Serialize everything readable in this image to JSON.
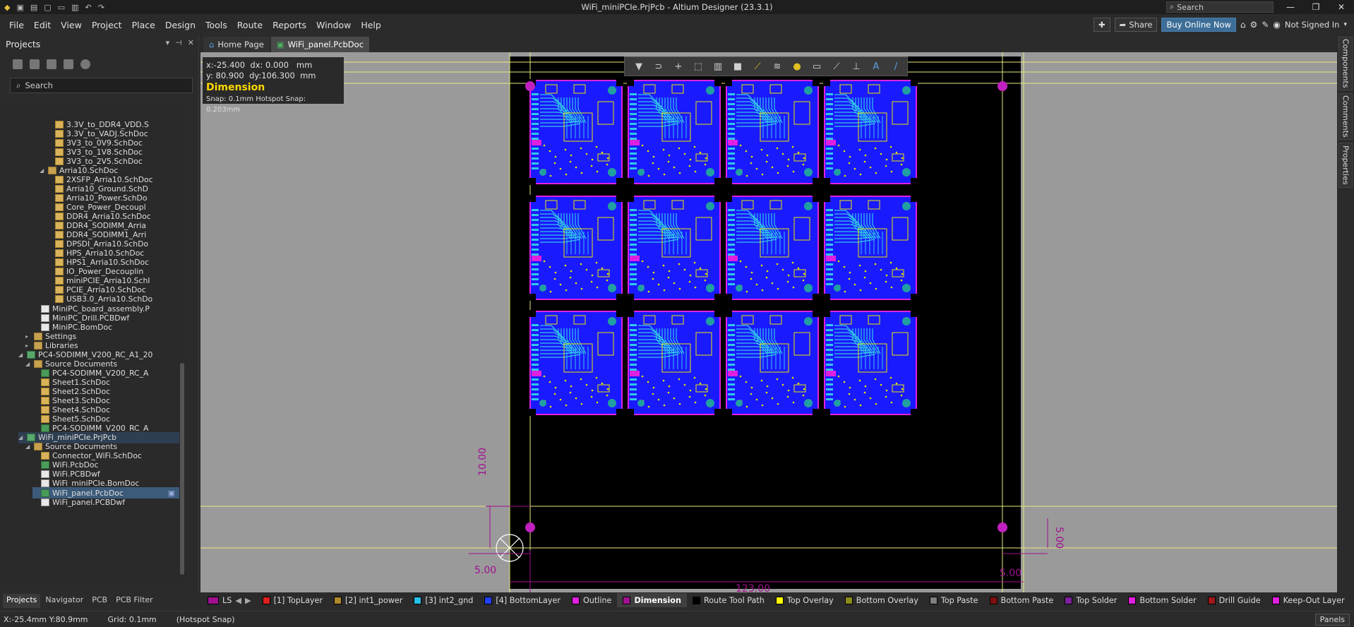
{
  "window": {
    "title": "WiFi_miniPCIe.PrjPcb - Altium Designer (23.3.1)",
    "search_placeholder": "Search"
  },
  "menu": [
    "File",
    "Edit",
    "View",
    "Project",
    "Place",
    "Design",
    "Tools",
    "Route",
    "Reports",
    "Window",
    "Help"
  ],
  "header_right": {
    "share": "Share",
    "buy": "Buy Online Now",
    "user": "Not Signed In"
  },
  "projects_panel": {
    "title": "Projects",
    "search_placeholder": "Search",
    "tabs": [
      "Projects",
      "Navigator",
      "PCB",
      "PCB Filter"
    ]
  },
  "tree": [
    {
      "label": "3.3V_to_DDR4_VDD.S",
      "type": "sch",
      "indent": 4
    },
    {
      "label": "3.3V_to_VADJ.SchDoc",
      "type": "sch",
      "indent": 4
    },
    {
      "label": "3V3_to_0V9.SchDoc",
      "type": "sch",
      "indent": 4
    },
    {
      "label": "3V3_to_1V8.SchDoc",
      "type": "sch",
      "indent": 4
    },
    {
      "label": "3V3_to_2V5.SchDoc",
      "type": "sch",
      "indent": 4
    },
    {
      "label": "Arria10.SchDoc",
      "type": "folder",
      "indent": 3,
      "arrow": "▲"
    },
    {
      "label": "2XSFP_Arria10.SchDoc",
      "type": "sch",
      "indent": 4
    },
    {
      "label": "Arria10_Ground.SchD",
      "type": "sch",
      "indent": 4
    },
    {
      "label": "Arria10_Power.SchDo",
      "type": "sch",
      "indent": 4
    },
    {
      "label": "Core_Power_Decoupl",
      "type": "sch",
      "indent": 4
    },
    {
      "label": "DDR4_Arria10.SchDoc",
      "type": "sch",
      "indent": 4
    },
    {
      "label": "DDR4_SODIMM_Arria",
      "type": "sch",
      "indent": 4
    },
    {
      "label": "DDR4_SODIMM1_Arri",
      "type": "sch",
      "indent": 4
    },
    {
      "label": "DPSDI_Arria10.SchDo",
      "type": "sch",
      "indent": 4
    },
    {
      "label": "HPS_Arria10.SchDoc",
      "type": "sch",
      "indent": 4
    },
    {
      "label": "HPS1_Arria10.SchDoc",
      "type": "sch",
      "indent": 4
    },
    {
      "label": "IO_Power_Decouplin",
      "type": "sch",
      "indent": 4
    },
    {
      "label": "miniPCIE_Arria10.SchI",
      "type": "sch",
      "indent": 4
    },
    {
      "label": "PCIE_Arria10.SchDoc",
      "type": "sch",
      "indent": 4
    },
    {
      "label": "USB3.0_Arria10.SchDo",
      "type": "sch",
      "indent": 4
    },
    {
      "label": "MiniPC_board_assembly.P",
      "type": "doc",
      "indent": 2
    },
    {
      "label": "MiniPC_Drill.PCBDwf",
      "type": "doc",
      "indent": 2
    },
    {
      "label": "MiniPC.BomDoc",
      "type": "doc",
      "indent": 2
    },
    {
      "label": "Settings",
      "type": "folder",
      "indent": 1,
      "arrow": "▶"
    },
    {
      "label": "Libraries",
      "type": "folder",
      "indent": 1,
      "arrow": "▶"
    },
    {
      "label": "PC4-SODIMM_V200_RC_A1_20",
      "type": "prj",
      "indent": 0,
      "arrow": "▲"
    },
    {
      "label": "Source Documents",
      "type": "folder",
      "indent": 1,
      "arrow": "▲"
    },
    {
      "label": "PC4-SODIMM_V200_RC_A",
      "type": "pcb",
      "indent": 2
    },
    {
      "label": "Sheet1.SchDoc",
      "type": "sch",
      "indent": 2
    },
    {
      "label": "Sheet2.SchDoc",
      "type": "sch",
      "indent": 2
    },
    {
      "label": "Sheet3.SchDoc",
      "type": "sch",
      "indent": 2
    },
    {
      "label": "Sheet4.SchDoc",
      "type": "sch",
      "indent": 2
    },
    {
      "label": "Sheet5.SchDoc",
      "type": "sch",
      "indent": 2
    },
    {
      "label": "PC4-SODIMM_V200_RC_A",
      "type": "pcb",
      "indent": 2
    },
    {
      "label": "WiFi_miniPCIe.PrjPcb",
      "type": "prj",
      "indent": 0,
      "arrow": "▲",
      "state": "hl"
    },
    {
      "label": "Source Documents",
      "type": "folder",
      "indent": 1,
      "arrow": "▲"
    },
    {
      "label": "Connector_WiFi.SchDoc",
      "type": "sch",
      "indent": 2
    },
    {
      "label": "WiFi.PcbDoc",
      "type": "pcb",
      "indent": 2
    },
    {
      "label": "WiFi.PCBDwf",
      "type": "doc",
      "indent": 2
    },
    {
      "label": "WiFi_miniPCIe.BomDoc",
      "type": "doc",
      "indent": 2
    },
    {
      "label": "WiFi_panel.PcbDoc",
      "type": "pcb",
      "indent": 2,
      "state": "sel"
    },
    {
      "label": "WiFi_panel.PCBDwf",
      "type": "doc",
      "indent": 2
    }
  ],
  "doc_tabs": [
    "Home Page",
    "WiFi_panel.PcbDoc"
  ],
  "right_tabs": [
    "Components",
    "Comments",
    "Properties"
  ],
  "coords": {
    "x": "x:-25.400",
    "dx": "dx:  0.000",
    "unit": "mm",
    "y": "y: 80.900",
    "dy": "dy:106.300",
    "mode": "Dimension",
    "snap": "Snap: 0.1mm Hotspot Snap: 0.203mm"
  },
  "dimensions": {
    "left_vertical": "10.00",
    "left_horizontal": "5.00",
    "bottom": "123.00",
    "right_horizontal": "5.00",
    "right_vertical": "5.00"
  },
  "layers": {
    "ls": "LS",
    "items": [
      {
        "label": "[1] TopLayer",
        "color": "#e02020"
      },
      {
        "label": "[2] int1_power",
        "color": "#b08a2a"
      },
      {
        "label": "[3] int2_gnd",
        "color": "#26c0e8"
      },
      {
        "label": "[4] BottomLayer",
        "color": "#2040ff"
      },
      {
        "label": "Outline",
        "color": "#e020e0"
      },
      {
        "label": "Dimension",
        "color": "#a01090",
        "active": true
      },
      {
        "label": "Route Tool Path",
        "color": "#000000"
      },
      {
        "label": "Top Overlay",
        "color": "#ffff00"
      },
      {
        "label": "Bottom Overlay",
        "color": "#8c8c1c"
      },
      {
        "label": "Top Paste",
        "color": "#808080"
      },
      {
        "label": "Bottom Paste",
        "color": "#801010"
      },
      {
        "label": "Top Solder",
        "color": "#8020a0"
      },
      {
        "label": "Bottom Solder",
        "color": "#e020e0"
      },
      {
        "label": "Drill Guide",
        "color": "#a01818"
      },
      {
        "label": "Keep-Out Layer",
        "color": "#e020e0"
      },
      {
        "label": "Drill Drawing",
        "color": "#e02020"
      }
    ]
  },
  "status": {
    "coords": "X:-25.4mm Y:80.9mm",
    "grid": "Grid: 0.1mm",
    "snap": "(Hotspot Snap)",
    "panels": "Panels"
  },
  "colors": {
    "board": "#1a1aff",
    "cutout": "#ffffff",
    "outline": "#e020e0",
    "trace": "#30c8e8",
    "overlay": "#e6e600"
  }
}
